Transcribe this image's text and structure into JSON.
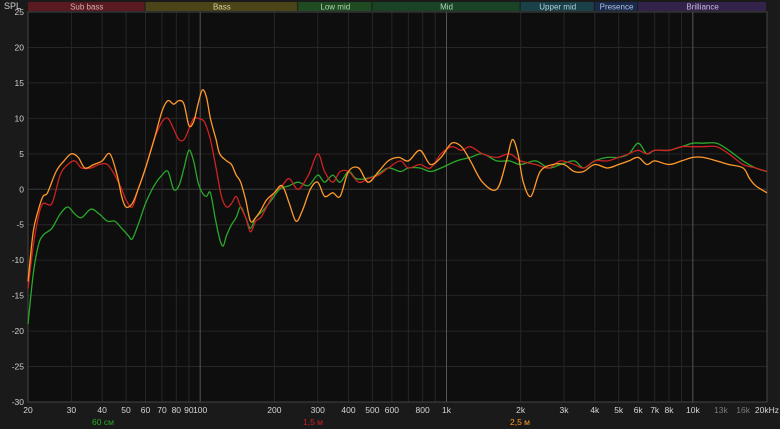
{
  "chart_data": {
    "type": "line",
    "ylabel": "SPL",
    "xscale": "log",
    "xlim": [
      20,
      20000
    ],
    "ylim": [
      -30,
      25
    ],
    "grid": true,
    "yticks": [
      25,
      20,
      15,
      10,
      5,
      0,
      -5,
      -10,
      -15,
      -20,
      -25,
      -30
    ],
    "xticks": [
      {
        "value": 20,
        "label": "20"
      },
      {
        "value": 30,
        "label": "30"
      },
      {
        "value": 40,
        "label": "40"
      },
      {
        "value": 50,
        "label": "50"
      },
      {
        "value": 60,
        "label": "60"
      },
      {
        "value": 70,
        "label": "70"
      },
      {
        "value": 80,
        "label": "80"
      },
      {
        "value": 90,
        "label": "90"
      },
      {
        "value": 100,
        "label": "100"
      },
      {
        "value": 200,
        "label": "200"
      },
      {
        "value": 300,
        "label": "300"
      },
      {
        "value": 400,
        "label": "400"
      },
      {
        "value": 500,
        "label": "500"
      },
      {
        "value": 600,
        "label": "600"
      },
      {
        "value": 800,
        "label": "800"
      },
      {
        "value": 1000,
        "label": "1k"
      },
      {
        "value": 2000,
        "label": "2k"
      },
      {
        "value": 3000,
        "label": "3k"
      },
      {
        "value": 4000,
        "label": "4k"
      },
      {
        "value": 5000,
        "label": "5k"
      },
      {
        "value": 6000,
        "label": "6k"
      },
      {
        "value": 7000,
        "label": "7k"
      },
      {
        "value": 8000,
        "label": "8k"
      },
      {
        "value": 10000,
        "label": "10k"
      },
      {
        "value": 13000,
        "label": "13k"
      },
      {
        "value": 16000,
        "label": "16k"
      },
      {
        "value": 20000,
        "label": "20kHz"
      }
    ],
    "bands": [
      {
        "name": "Sub bass",
        "from": 20,
        "to": 60,
        "color": "#5a1a22",
        "text": "#d8b0b0"
      },
      {
        "name": "Bass",
        "from": 60,
        "to": 250,
        "color": "#4a4418",
        "text": "#d8d0a0"
      },
      {
        "name": "Low mid",
        "from": 250,
        "to": 500,
        "color": "#1f4a22",
        "text": "#b0d8b0"
      },
      {
        "name": "Mid",
        "from": 500,
        "to": 2000,
        "color": "#1a4224",
        "text": "#b0d8b8"
      },
      {
        "name": "Upper mid",
        "from": 2000,
        "to": 4000,
        "color": "#1a4048",
        "text": "#b0d0d8"
      },
      {
        "name": "Presence",
        "from": 4000,
        "to": 6000,
        "color": "#1a2a4a",
        "text": "#b0c0e0"
      },
      {
        "name": "Brilliance",
        "from": 6000,
        "to": 20000,
        "color": "#33224a",
        "text": "#c8b8e0"
      }
    ],
    "series": [
      {
        "name": "60 см",
        "color": "#2aa82a",
        "points": [
          [
            20,
            -19
          ],
          [
            21,
            -12
          ],
          [
            22,
            -8
          ],
          [
            23,
            -6.5
          ],
          [
            25,
            -5.5
          ],
          [
            27,
            -3.5
          ],
          [
            29,
            -2.5
          ],
          [
            31,
            -3.5
          ],
          [
            33,
            -4
          ],
          [
            36,
            -2.8
          ],
          [
            39,
            -3.5
          ],
          [
            42,
            -4.5
          ],
          [
            45,
            -4.5
          ],
          [
            48,
            -5.5
          ],
          [
            51,
            -6.5
          ],
          [
            53,
            -7
          ],
          [
            56,
            -5
          ],
          [
            60,
            -2
          ],
          [
            65,
            0.5
          ],
          [
            70,
            2
          ],
          [
            74,
            2.5
          ],
          [
            78,
            0
          ],
          [
            82,
            0.5
          ],
          [
            86,
            3
          ],
          [
            90,
            5.5
          ],
          [
            94,
            4
          ],
          [
            98,
            1
          ],
          [
            102,
            -0.5
          ],
          [
            106,
            -1
          ],
          [
            110,
            -0.5
          ],
          [
            115,
            -4
          ],
          [
            120,
            -7
          ],
          [
            124,
            -8
          ],
          [
            128,
            -6.5
          ],
          [
            134,
            -5
          ],
          [
            140,
            -4
          ],
          [
            146,
            -2.5
          ],
          [
            153,
            -4
          ],
          [
            160,
            -5.5
          ],
          [
            168,
            -4
          ],
          [
            180,
            -3
          ],
          [
            195,
            -1.5
          ],
          [
            210,
            0
          ],
          [
            230,
            0.5
          ],
          [
            250,
            1
          ],
          [
            275,
            0.5
          ],
          [
            300,
            2
          ],
          [
            320,
            1
          ],
          [
            345,
            2
          ],
          [
            370,
            1
          ],
          [
            400,
            2.5
          ],
          [
            430,
            1.5
          ],
          [
            470,
            1.5
          ],
          [
            520,
            2
          ],
          [
            580,
            3
          ],
          [
            650,
            2.5
          ],
          [
            700,
            3
          ],
          [
            780,
            3
          ],
          [
            860,
            2.5
          ],
          [
            950,
            3
          ],
          [
            1100,
            4
          ],
          [
            1250,
            4.5
          ],
          [
            1400,
            5
          ],
          [
            1600,
            4
          ],
          [
            1800,
            4
          ],
          [
            2000,
            3.5
          ],
          [
            2300,
            4
          ],
          [
            2600,
            3
          ],
          [
            2900,
            3.5
          ],
          [
            3300,
            4
          ],
          [
            3600,
            3
          ],
          [
            4000,
            4
          ],
          [
            4500,
            4.5
          ],
          [
            5000,
            4.5
          ],
          [
            5500,
            5
          ],
          [
            6000,
            6.5
          ],
          [
            6500,
            5
          ],
          [
            7000,
            5.5
          ],
          [
            8000,
            5.5
          ],
          [
            9000,
            6
          ],
          [
            10000,
            6.5
          ],
          [
            11000,
            6.5
          ],
          [
            12500,
            6.5
          ],
          [
            14000,
            5.5
          ],
          [
            16000,
            4
          ],
          [
            18000,
            3
          ],
          [
            20000,
            2.5
          ]
        ]
      },
      {
        "name": "1,5 м",
        "color": "#cc2222",
        "points": [
          [
            20,
            -14
          ],
          [
            21,
            -8
          ],
          [
            22,
            -4
          ],
          [
            23,
            -2
          ],
          [
            25,
            -2
          ],
          [
            27,
            2
          ],
          [
            29,
            3.5
          ],
          [
            31,
            4
          ],
          [
            33,
            3
          ],
          [
            36,
            3
          ],
          [
            39,
            3.5
          ],
          [
            42,
            3.5
          ],
          [
            45,
            2
          ],
          [
            48,
            0
          ],
          [
            50,
            -1.5
          ],
          [
            53,
            -2.5
          ],
          [
            56,
            0
          ],
          [
            60,
            3
          ],
          [
            65,
            7
          ],
          [
            70,
            9.5
          ],
          [
            74,
            10
          ],
          [
            78,
            8.5
          ],
          [
            82,
            7
          ],
          [
            86,
            7
          ],
          [
            90,
            8.5
          ],
          [
            94,
            10
          ],
          [
            98,
            10
          ],
          [
            104,
            9.5
          ],
          [
            110,
            7
          ],
          [
            116,
            3
          ],
          [
            122,
            -1
          ],
          [
            128,
            -2.5
          ],
          [
            134,
            -2
          ],
          [
            140,
            -1
          ],
          [
            146,
            -2.5
          ],
          [
            153,
            -4
          ],
          [
            160,
            -6
          ],
          [
            168,
            -4.5
          ],
          [
            176,
            -4
          ],
          [
            186,
            -2.5
          ],
          [
            200,
            -0.5
          ],
          [
            215,
            0.5
          ],
          [
            230,
            1.5
          ],
          [
            250,
            0
          ],
          [
            275,
            2
          ],
          [
            300,
            5
          ],
          [
            320,
            2.5
          ],
          [
            345,
            1
          ],
          [
            370,
            2.5
          ],
          [
            400,
            2.5
          ],
          [
            440,
            1
          ],
          [
            480,
            1.5
          ],
          [
            530,
            2
          ],
          [
            580,
            3
          ],
          [
            650,
            4
          ],
          [
            700,
            3
          ],
          [
            780,
            3.5
          ],
          [
            860,
            3
          ],
          [
            950,
            5
          ],
          [
            1050,
            6
          ],
          [
            1150,
            5.5
          ],
          [
            1250,
            6
          ],
          [
            1400,
            5
          ],
          [
            1600,
            4.5
          ],
          [
            1800,
            5
          ],
          [
            2000,
            4
          ],
          [
            2300,
            3.5
          ],
          [
            2600,
            3
          ],
          [
            2900,
            4
          ],
          [
            3300,
            3.5
          ],
          [
            3600,
            3
          ],
          [
            4000,
            4
          ],
          [
            4500,
            4
          ],
          [
            5000,
            4.5
          ],
          [
            5500,
            5
          ],
          [
            6000,
            5.5
          ],
          [
            6500,
            5
          ],
          [
            7000,
            5.5
          ],
          [
            8000,
            5.5
          ],
          [
            9000,
            6
          ],
          [
            10000,
            6
          ],
          [
            11000,
            6
          ],
          [
            12500,
            6
          ],
          [
            14000,
            5
          ],
          [
            16000,
            3.5
          ],
          [
            18000,
            3
          ],
          [
            20000,
            2.5
          ]
        ]
      },
      {
        "name": "2,5 м",
        "color": "#ff9a2a",
        "points": [
          [
            20,
            -13
          ],
          [
            21,
            -6
          ],
          [
            22,
            -3
          ],
          [
            23,
            -1
          ],
          [
            24,
            -0.5
          ],
          [
            26,
            2.5
          ],
          [
            28,
            4
          ],
          [
            30,
            5
          ],
          [
            32,
            4.5
          ],
          [
            34,
            3
          ],
          [
            37,
            3.5
          ],
          [
            40,
            4
          ],
          [
            43,
            5
          ],
          [
            46,
            2
          ],
          [
            48,
            -1
          ],
          [
            50,
            -2.5
          ],
          [
            53,
            -2
          ],
          [
            56,
            0
          ],
          [
            60,
            3
          ],
          [
            65,
            7
          ],
          [
            70,
            11
          ],
          [
            74,
            12.5
          ],
          [
            78,
            12
          ],
          [
            82,
            12.5
          ],
          [
            86,
            12
          ],
          [
            90,
            9
          ],
          [
            94,
            9.5
          ],
          [
            98,
            12
          ],
          [
            102,
            14
          ],
          [
            106,
            13
          ],
          [
            110,
            10
          ],
          [
            116,
            7
          ],
          [
            120,
            5
          ],
          [
            128,
            4
          ],
          [
            134,
            3.5
          ],
          [
            140,
            2
          ],
          [
            146,
            1
          ],
          [
            153,
            -1.5
          ],
          [
            160,
            -4.5
          ],
          [
            168,
            -4
          ],
          [
            176,
            -3
          ],
          [
            186,
            -1.5
          ],
          [
            200,
            -0.5
          ],
          [
            215,
            0.5
          ],
          [
            230,
            -2
          ],
          [
            245,
            -4.5
          ],
          [
            260,
            -3
          ],
          [
            280,
            0
          ],
          [
            300,
            1
          ],
          [
            320,
            -1
          ],
          [
            345,
            -0.5
          ],
          [
            370,
            -1
          ],
          [
            400,
            2.5
          ],
          [
            440,
            3
          ],
          [
            480,
            1
          ],
          [
            530,
            2.5
          ],
          [
            580,
            4
          ],
          [
            640,
            4.5
          ],
          [
            700,
            4
          ],
          [
            780,
            5.5
          ],
          [
            860,
            3.5
          ],
          [
            950,
            4.5
          ],
          [
            1050,
            6.5
          ],
          [
            1150,
            6
          ],
          [
            1250,
            4
          ],
          [
            1400,
            1
          ],
          [
            1600,
            0
          ],
          [
            1750,
            4
          ],
          [
            1850,
            7
          ],
          [
            1950,
            5
          ],
          [
            2050,
            1
          ],
          [
            2200,
            -1
          ],
          [
            2400,
            2.5
          ],
          [
            2700,
            3.5
          ],
          [
            3000,
            3.5
          ],
          [
            3300,
            2.5
          ],
          [
            3600,
            2.5
          ],
          [
            4000,
            3.5
          ],
          [
            4500,
            3
          ],
          [
            5000,
            3.5
          ],
          [
            5500,
            4
          ],
          [
            6000,
            4.5
          ],
          [
            6500,
            3.5
          ],
          [
            7000,
            4
          ],
          [
            8000,
            3.5
          ],
          [
            9000,
            4
          ],
          [
            10000,
            4.5
          ],
          [
            11000,
            4.5
          ],
          [
            12500,
            4
          ],
          [
            14000,
            3.5
          ],
          [
            16000,
            3
          ],
          [
            17000,
            1.5
          ],
          [
            18000,
            0.5
          ],
          [
            20000,
            -0.5
          ]
        ]
      }
    ]
  }
}
